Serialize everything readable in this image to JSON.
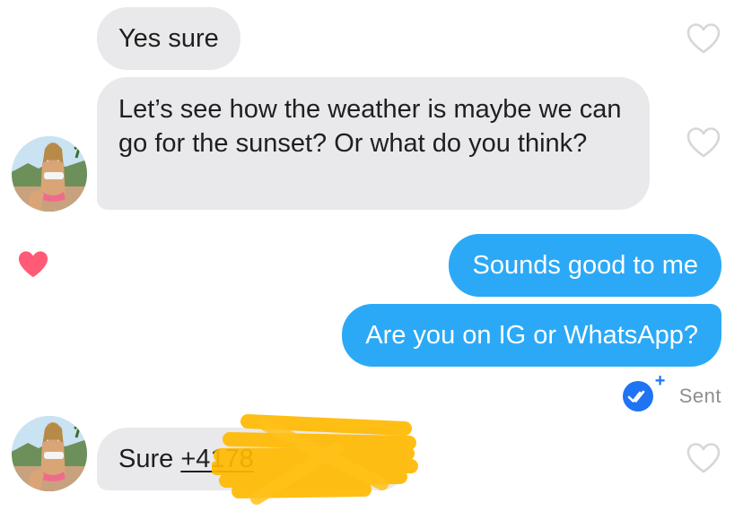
{
  "messages": [
    {
      "id": "m1",
      "direction": "incoming",
      "text": "Yes sure",
      "liked": false
    },
    {
      "id": "m2",
      "direction": "incoming",
      "text": "Let’s see how the weather is maybe we can go for the sunset? Or what do you think?",
      "liked": false
    },
    {
      "id": "m3",
      "direction": "outgoing",
      "text": "Sounds good to me",
      "liked": true
    },
    {
      "id": "m4",
      "direction": "outgoing",
      "text": "Are you on IG or WhatsApp?"
    },
    {
      "id": "m5",
      "direction": "incoming",
      "text_prefix": "Sure ",
      "phone_visible": "+4178",
      "redacted": true,
      "liked": false
    }
  ],
  "status": {
    "label": "Sent",
    "icon": "double-check-icon"
  },
  "colors": {
    "incoming_bubble": "#e9e9eb",
    "outgoing_bubble": "#2ba9f7",
    "like_active": "#ff5a76",
    "read_badge": "#1e74f2",
    "redaction": "#ffb800"
  }
}
